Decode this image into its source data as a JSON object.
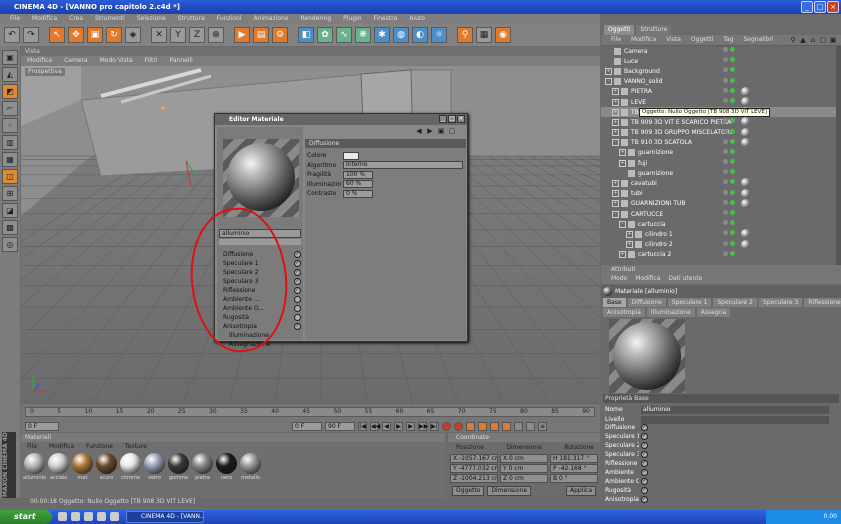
{
  "window": {
    "title": "CINEMA 4D - [VANNO pro capitolo 2.c4d *]"
  },
  "menubar": [
    "File",
    "Modifica",
    "Crea",
    "Strumenti",
    "Selezione",
    "Struttura",
    "Funzioni",
    "Animazione",
    "Rendering",
    "Plugin",
    "Finestra",
    "Aiuto"
  ],
  "viewport": {
    "tabs": "Vista",
    "menu": [
      "Modifica",
      "Camera",
      "Modo Vista",
      "Filtri",
      "Pannelli"
    ],
    "label": "Prospettiva"
  },
  "timeline": {
    "ticks": [
      "0",
      "5",
      "10",
      "15",
      "20",
      "25",
      "30",
      "35",
      "40",
      "45",
      "50",
      "55",
      "60",
      "65",
      "70",
      "75",
      "80",
      "85",
      "90"
    ],
    "current": "0 F",
    "start": "0 F",
    "end": "90 F"
  },
  "materials": {
    "title": "Materiali",
    "menu": [
      "File",
      "Modifica",
      "Funzione",
      "Texture"
    ],
    "items": [
      {
        "name": "alluminio",
        "color": "#b8b8b8"
      },
      {
        "name": "acciaio",
        "color": "#d0d0d0"
      },
      {
        "name": "mat",
        "color": "#b07a3a"
      },
      {
        "name": "scuro",
        "color": "#6a4a30"
      },
      {
        "name": "chrome",
        "color": "#e8e8e8"
      },
      {
        "name": "vetro",
        "color": "#9a9fb8"
      },
      {
        "name": "gomma",
        "color": "#3a3a3a"
      },
      {
        "name": "pietra",
        "color": "#888888"
      },
      {
        "name": "nero",
        "color": "#1a1a1a"
      },
      {
        "name": "metallo",
        "color": "#9a9a9a"
      }
    ]
  },
  "coords": {
    "title": "Coordinate",
    "cols": [
      "Posizione",
      "Dimensione",
      "Rotazione"
    ],
    "rows": [
      {
        "p": "X  -1057.167 cm",
        "d": "X  0 cm",
        "r": "H  181.317 °"
      },
      {
        "p": "Y  -4777.032 cm",
        "d": "Y  0 cm",
        "r": "P  -42.168 °"
      },
      {
        "p": "Z  -1004.213 cm",
        "d": "Z  0 cm",
        "r": "B  0 °"
      }
    ],
    "buttons": [
      "Oggetto",
      "Dimensione",
      "Applica"
    ]
  },
  "objects": {
    "tabs": [
      "Oggetti",
      "Strutture"
    ],
    "menu": [
      "File",
      "Modifica",
      "Vista",
      "Oggetti",
      "Tag",
      "Segnalibri"
    ],
    "rows": [
      {
        "label": "Camera",
        "depth": 0,
        "exp": "",
        "tags": 0
      },
      {
        "label": "Luce",
        "depth": 0,
        "exp": "",
        "tags": 0
      },
      {
        "label": "Background",
        "depth": 0,
        "exp": "+",
        "tags": 0
      },
      {
        "label": "VANNO_solid",
        "depth": 0,
        "exp": "-",
        "tags": 0
      },
      {
        "label": "PIETRA",
        "depth": 1,
        "exp": "+",
        "tags": 1
      },
      {
        "label": "LEVE",
        "depth": 1,
        "exp": "+",
        "tags": 1
      },
      {
        "label": "TB 908",
        "depth": 1,
        "exp": "+",
        "tags": 1,
        "selected": true
      },
      {
        "label": "TB 909   3D VIT E SCARICO PIETRA",
        "depth": 1,
        "exp": "+",
        "tags": 1
      },
      {
        "label": "TB 909   3D GRUPPO MISCELATORE",
        "depth": 1,
        "exp": "+",
        "tags": 1
      },
      {
        "label": "TB 910   3D SCATOLA",
        "depth": 1,
        "exp": "-",
        "tags": 1
      },
      {
        "label": "guarnizione",
        "depth": 2,
        "exp": "+",
        "tags": 0
      },
      {
        "label": "fuji",
        "depth": 2,
        "exp": "+",
        "tags": 0
      },
      {
        "label": "guarnizione",
        "depth": 2,
        "exp": "",
        "tags": 0
      },
      {
        "label": "cavatubi",
        "depth": 1,
        "exp": "+",
        "tags": 1
      },
      {
        "label": "tubi",
        "depth": 1,
        "exp": "+",
        "tags": 1
      },
      {
        "label": "GUARNIZIONI TUB",
        "depth": 1,
        "exp": "+",
        "tags": 1
      },
      {
        "label": "CARTUCCE",
        "depth": 1,
        "exp": "-",
        "tags": 0
      },
      {
        "label": "cartuccia",
        "depth": 2,
        "exp": "-",
        "tags": 0
      },
      {
        "label": "cilindro 1",
        "depth": 3,
        "exp": "+",
        "tags": 1
      },
      {
        "label": "cilindro 2",
        "depth": 3,
        "exp": "+",
        "tags": 1
      },
      {
        "label": "cartuccia 2",
        "depth": 2,
        "exp": "+",
        "tags": 0
      }
    ],
    "tooltip": "Oggetto: Nullo Oggetto [TB 908   3D VIT  LEVE]"
  },
  "attributes": {
    "title": "Attributi",
    "menu": [
      "Modo",
      "Modifica",
      "Dati utente"
    ],
    "material": "Materiale [alluminio]",
    "tabs": [
      "Base",
      "Diffusione",
      "Speculare 1",
      "Speculare 2",
      "Speculare 3",
      "Riflessione"
    ],
    "tabs2": [
      "Anisotropia",
      "Illuminazione",
      "Assegna"
    ],
    "section": "Proprietà Base",
    "name_label": "Nome",
    "name_value": "alluminio",
    "layer_label": "Livello",
    "channels": [
      "Diffusione",
      "Speculare 1",
      "Speculare 2",
      "Speculare 3",
      "Riflessione",
      "Ambiente",
      "Ambiente Oc.",
      "Rugosità",
      "Anisotropia"
    ]
  },
  "editor": {
    "title": "Editor Materiale",
    "name": "alluminio",
    "channels": [
      {
        "label": "Diffusione",
        "checked": true
      },
      {
        "label": "Speculare 1",
        "checked": true
      },
      {
        "label": "Speculare 2",
        "checked": true
      },
      {
        "label": "Speculare 3",
        "checked": true
      },
      {
        "label": "Riflessione",
        "checked": true
      },
      {
        "label": "Ambiente ...",
        "checked": false
      },
      {
        "label": "Ambiente O...",
        "checked": false
      },
      {
        "label": "Rugosità",
        "checked": false
      },
      {
        "label": "Anisotropia",
        "checked": true
      }
    ],
    "extra": [
      "Illuminazione",
      "Assegnazione"
    ],
    "section": "Diffusione",
    "fields": [
      {
        "label": "Colore",
        "value": ""
      },
      {
        "label": "Algoritmo",
        "value": "Interno"
      },
      {
        "label": "Fragilità",
        "value": "100 %"
      },
      {
        "label": "Illuminazione",
        "value": "60 %"
      },
      {
        "label": "Contrasto",
        "value": "0 %"
      }
    ]
  },
  "status": "00:00:18  Oggetto: Nullo Oggetto [TB 908   3D VIT LEVE]",
  "logo": "MAXON CINEMA 4D",
  "taskbar": {
    "start": "start",
    "task": "CINEMA 4D - [VANN...",
    "clock": "0.00"
  }
}
